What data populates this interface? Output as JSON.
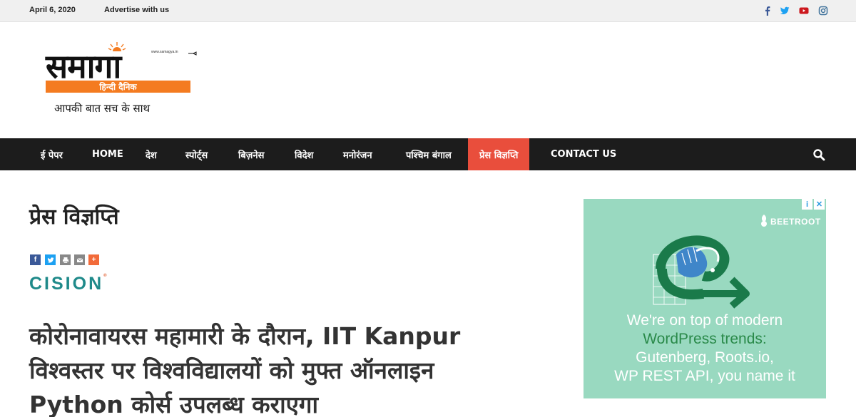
{
  "topbar": {
    "date": "April 6, 2020",
    "advertise": "Advertise with us",
    "social": [
      "facebook-icon",
      "twitter-icon",
      "youtube-icon",
      "instagram-icon"
    ]
  },
  "logo": {
    "wordmark": "समागा",
    "band_text": "हिन्दी दैनिक",
    "site": "www.samagya.in",
    "tagline": "आपकी बात सच के साथ"
  },
  "nav": {
    "items": [
      {
        "label": "ई पेपर"
      },
      {
        "label": "HOME"
      },
      {
        "label": "देश"
      },
      {
        "label": "स्पोर्ट्स"
      },
      {
        "label": "बिज़नेस"
      },
      {
        "label": "विदेश"
      },
      {
        "label": "मनोरंजन"
      },
      {
        "label": "पश्चिम बंगाल"
      },
      {
        "label": "प्रेस विज्ञप्ति",
        "active": true
      },
      {
        "label": "CONTACT US"
      }
    ],
    "search_icon": "search-icon"
  },
  "main": {
    "page_title": "प्रेस विज्ञप्ति",
    "share_icons": [
      "facebook-icon",
      "twitter-icon",
      "print-icon",
      "email-icon",
      "plus-icon"
    ],
    "source_logo": "CISION",
    "headline": "कोरोनावायरस महामारी के दौरान, IIT Kanpur विश्वस्तर पर विश्वविद्यालयों को मुफ्त ऑनलाइन Python कोर्स उपलब्ध कराएगा"
  },
  "ad": {
    "brand": "BEETROOT",
    "line1": "We're on top of modern",
    "line2": "WordPress trends:",
    "line3": "Gutenberg, Roots.io,",
    "line4": "WP REST API, you name it",
    "highlight_line": "WordPress trends:"
  },
  "colors": {
    "nav_bg": "#1c1c1c",
    "nav_active": "#e94e3c",
    "logo_orange": "#f47b20",
    "ad_bg": "#99d9c0",
    "cision_teal": "#1f8a8a"
  }
}
